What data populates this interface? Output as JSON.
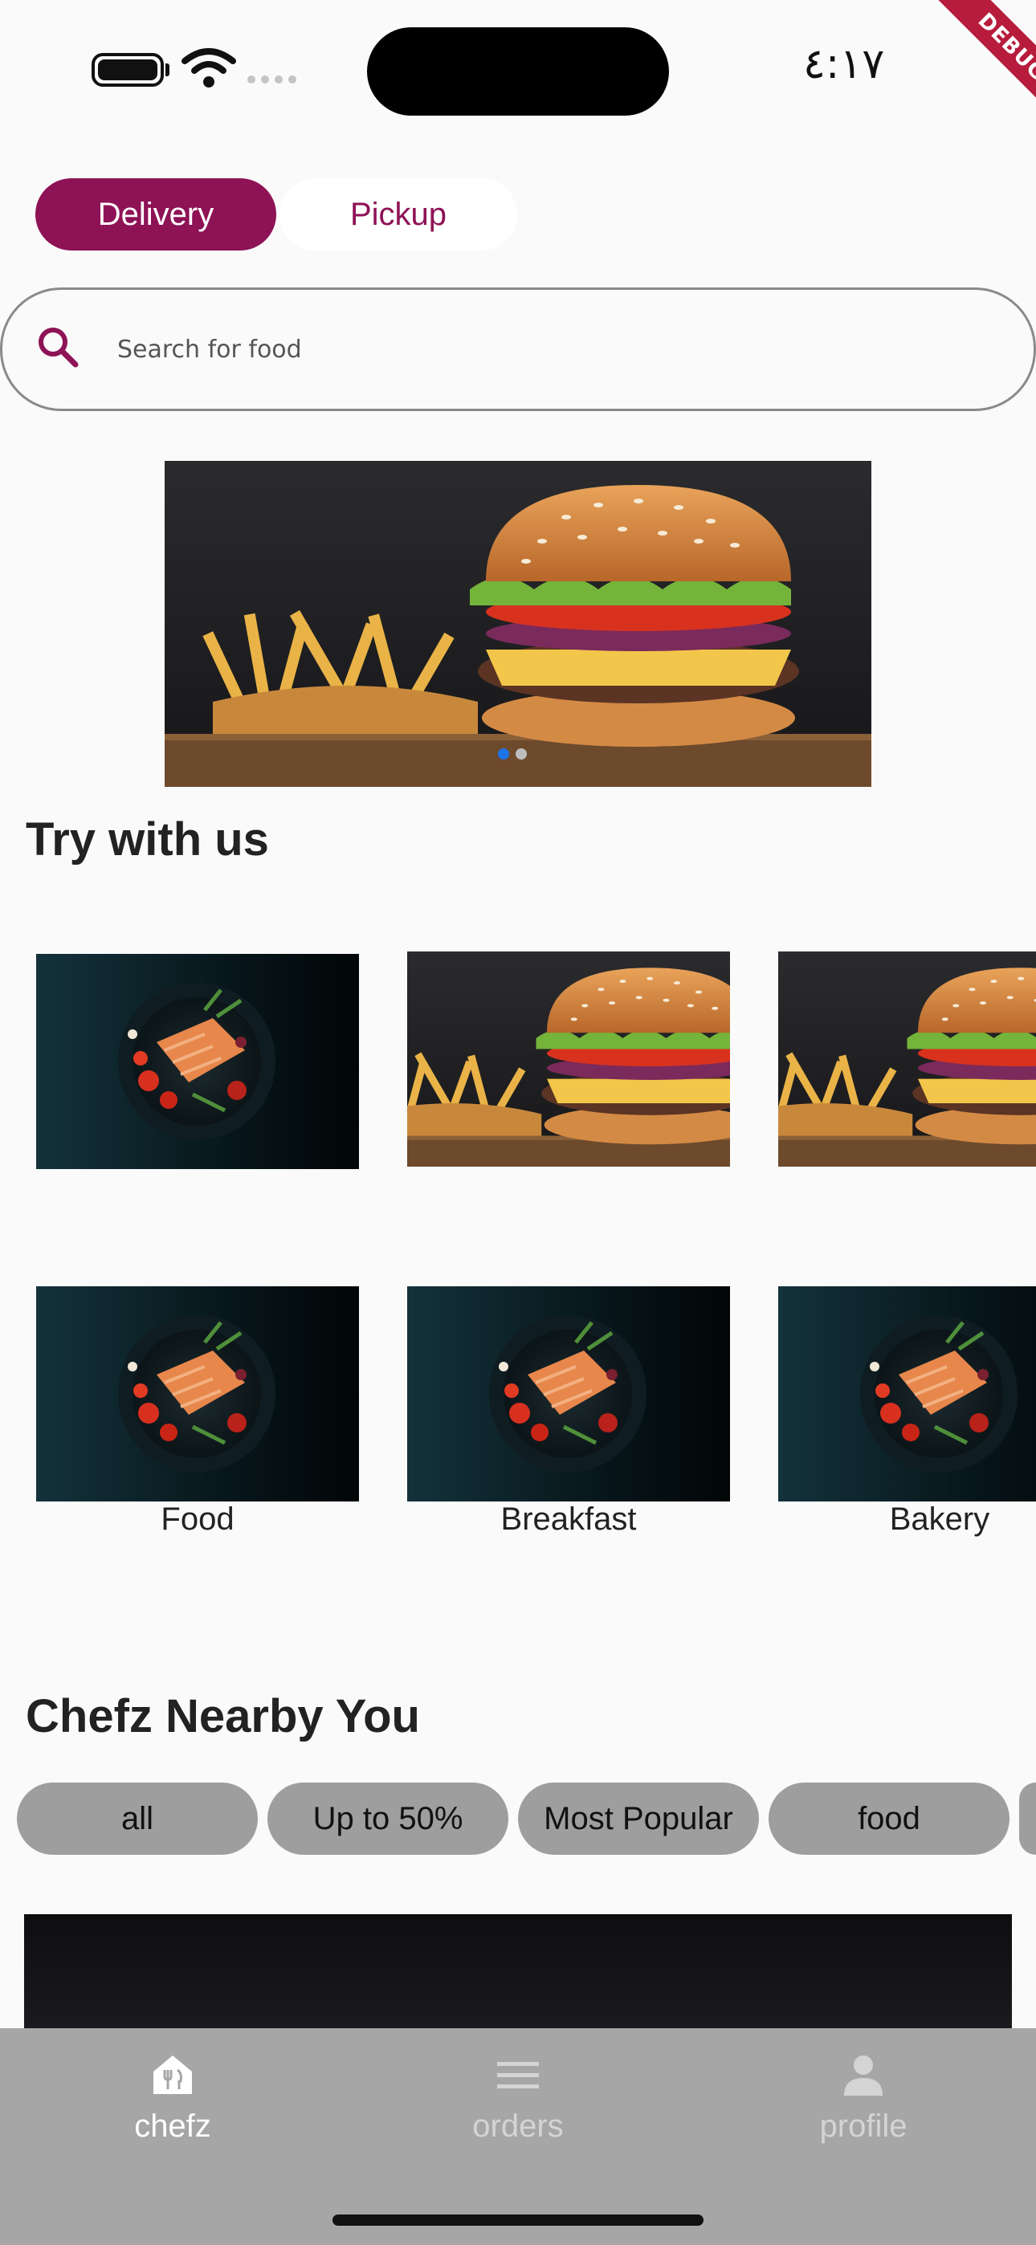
{
  "status_bar": {
    "time": "٤:١٧",
    "debug_label": "DEBUG"
  },
  "mode_toggle": {
    "delivery_label": "Delivery",
    "pickup_label": "Pickup",
    "selected": "Delivery",
    "accent_color": "#8e1256"
  },
  "search": {
    "placeholder": "Search for food",
    "value": ""
  },
  "banner": {
    "image": "burger-and-fries",
    "page_count": 2,
    "active_page": 1
  },
  "try_section": {
    "title": "Try with us",
    "row1": [
      {
        "image": "salmon-plate"
      },
      {
        "image": "burger-and-fries"
      },
      {
        "image": "burger-and-fries"
      }
    ],
    "row2": [
      {
        "image": "salmon-plate",
        "label": "Food"
      },
      {
        "image": "salmon-plate",
        "label": "Breakfast"
      },
      {
        "image": "salmon-plate",
        "label": "Bakery"
      }
    ]
  },
  "nearby": {
    "title": "Chefz Nearby You",
    "filters": [
      "all",
      "Up to 50%",
      "Most Popular",
      "food"
    ]
  },
  "bottom_nav": {
    "items": [
      {
        "label": "chefz",
        "icon": "chef-house-icon",
        "active": true
      },
      {
        "label": "orders",
        "icon": "menu-lines-icon",
        "active": false
      },
      {
        "label": "profile",
        "icon": "person-icon",
        "active": false
      }
    ],
    "active_color": "#ffffff",
    "inactive_color": "#d4d4d4"
  }
}
